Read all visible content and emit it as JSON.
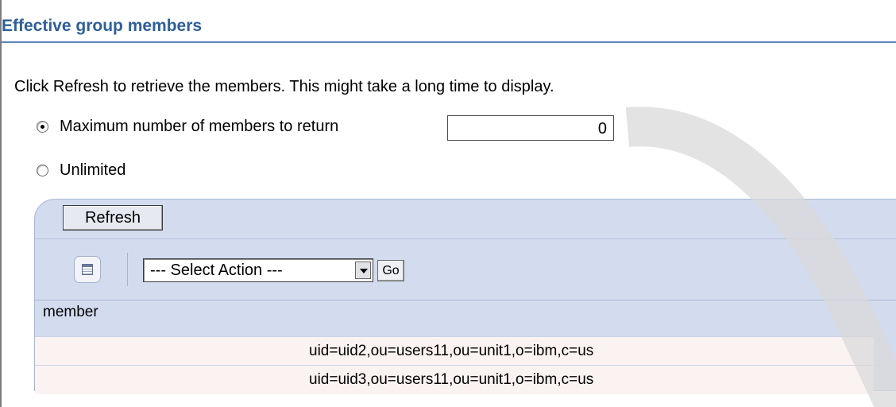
{
  "section": {
    "title": "Effective group members"
  },
  "intro_text": "Click Refresh to retrieve the members. This might take a long time to display.",
  "options": {
    "max_label": "Maximum number of members to return",
    "max_value": "0",
    "unlimited_label": "Unlimited",
    "selected": "max"
  },
  "panel": {
    "refresh_label": "Refresh",
    "table_icon": "table-icon",
    "select_action": "--- Select Action ---",
    "go_label": "Go"
  },
  "table": {
    "column_header": "member",
    "rows": [
      "uid=uid2,ou=users11,ou=unit1,o=ibm,c=us",
      "uid=uid3,ou=users11,ou=unit1,o=ibm,c=us"
    ]
  },
  "colors": {
    "title": "#2e5f98",
    "panel": "#d3dcef",
    "row": "#fbf3f1"
  }
}
